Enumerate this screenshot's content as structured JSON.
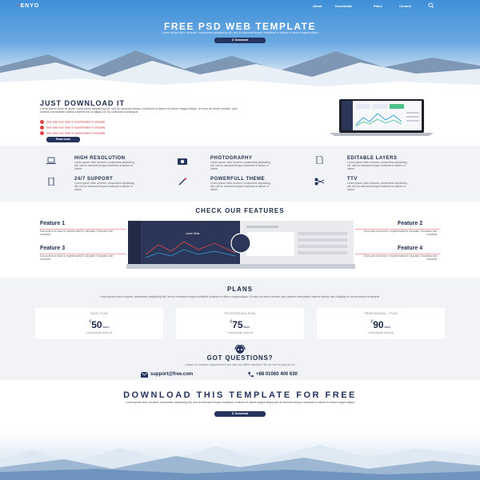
{
  "header": {
    "logo_mark": "▪",
    "logo_text": "ENYO",
    "nav": [
      "About",
      "Downloads",
      "Plans",
      "Contact"
    ]
  },
  "hero": {
    "title": "FREE PSD WEB TEMPLATE",
    "subtitle": "Lorem ipsum dolor sit amet, consectetur adipisicing elit, sed do eiusmod tempor incididunt ut labore et dolore magna aliqua",
    "button": "Download"
  },
  "just_download": {
    "title": "JUST DOWNLOAD IT",
    "text": "Lorem ipsum dolor sit amet, consectetur adipisicing elit, sed do eiusmod tempor incididunt ut labore et dolore magna aliqua. Ut enim ad minim veniam, quis nostrud exercitation ullamco laboris nisi ut aliquip ex ea commodo consequat.",
    "items": [
      "Duis aute irure dolor in reprehenderit in voluptate",
      "Duis aute irure dolor in reprehenderit in voluptate",
      "Duis aute irure dolor in reprehenderit in voluptate"
    ],
    "button": "Read more"
  },
  "features_grid": [
    {
      "icon": "laptop-icon",
      "title": "HIGH RESOLUTION",
      "text": "Lorem ipsum dolor sit amet, consectetur adipisicing elit, sed do eiusmod tempor incididunt ut labore et dolore"
    },
    {
      "icon": "camera-icon",
      "title": "PHOTOGRAPHY",
      "text": "Lorem ipsum dolor sit amet, consectetur adipisicing elit, sed do eiusmod tempor incididunt ut labore et dolore"
    },
    {
      "icon": "document-icon",
      "title": "EDITABLE LAYERS",
      "text": "Lorem ipsum dolor sit amet, consectetur adipisicing elit, sed do eiusmod tempor incididunt ut labore et dolore"
    },
    {
      "icon": "phone-icon",
      "title": "24/7 SUPPORT",
      "text": "Lorem ipsum dolor sit amet, consectetur adipisicing elit, sed do eiusmod tempor incididunt ut labore et dolore"
    },
    {
      "icon": "magic-wand-icon",
      "title": "POWERFULL THEME",
      "text": "Lorem ipsum dolor sit amet, consectetur adipisicing elit, sed do eiusmod tempor incididunt ut labore et dolore"
    },
    {
      "icon": "scissors-icon",
      "title": "TTV",
      "text": "Lorem ipsum dolor sit amet, consectetur adipisicing elit, sed do eiusmod tempor incididunt ut labore et dolore"
    }
  ],
  "check_features": {
    "title": "CHECK OUR FEATURES",
    "items": [
      {
        "title": "Feature 1",
        "text": "Duis aute irure dolor in reprehenderit in voluptate. Excepteur sint occaecat"
      },
      {
        "title": "Feature 2",
        "text": "Duis aute irure dolor in reprehenderit in voluptate. Excepteur sint occaecat"
      },
      {
        "title": "Feature 3",
        "text": "Duis aute irure dolor in reprehenderit in voluptate. Excepteur sint occaecat"
      },
      {
        "title": "Feature 4",
        "text": "Duis aute irure dolor in reprehenderit in voluptate. Excepteur sint occaecat"
      }
    ],
    "screen_title": "Lorem Stats"
  },
  "plans": {
    "title": "PLANS",
    "subtitle": "Lorem ipsum dolor sit amet, consectetur adipisicing elit, sed do eiusmod tempor incididunt ut labore et dolore magna aliqua. Ut enim ad minim veniam, quis nostrud exercitation ullamco laboris nisi ut aliquip ex ea commodo consequat.",
    "cards": [
      {
        "name": "BASIC PLAN",
        "currency": "€",
        "price": "50",
        "period": "/mon",
        "desc": "Lorem ipsum dolor sit"
      },
      {
        "name": "PROFESSIONAL PLAN",
        "currency": "€",
        "price": "75",
        "period": "/mon",
        "desc": "Lorem ipsum dolor sit"
      },
      {
        "name": "PROFESSIONAL + PLAN",
        "currency": "€",
        "price": "90",
        "period": "/mon",
        "desc": "Lorem ipsum dolor sit"
      }
    ]
  },
  "questions": {
    "title": "GOT QUESTIONS?",
    "subtitle": "contact our customer support team if you have any further questions. We are here to help you out",
    "email": "support@free.com",
    "phone": "+88 01060 400 630"
  },
  "download": {
    "title": "DOWNLOAD THIS TEMPLATE FOR FREE",
    "subtitle": "Lorem ipsum dolor sit amet, consectetur adipisicing elit, sed do eiusmod tempor incididunt ut labore et dolore magna aliqua sed do eiusmod tempor incididunt ut labore et dolore magna aliqua",
    "button": "Download"
  },
  "colors": {
    "accent": "#24345e",
    "red": "#e04848",
    "hero_blue": "#3f8fd9"
  }
}
